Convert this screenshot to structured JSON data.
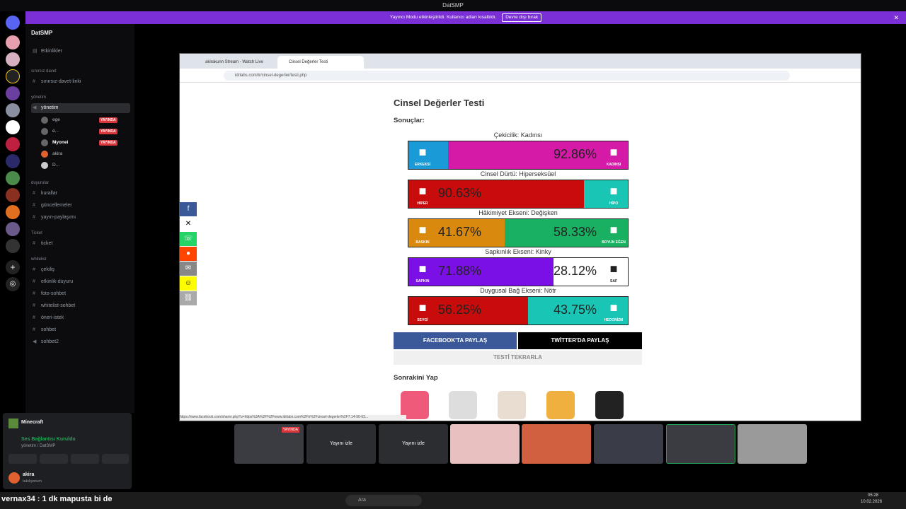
{
  "window_title": "DatSMP",
  "banner": {
    "text": "Yayıncı Modu etkinleştirildi. Kullanıcı adları kısaltıldı.",
    "button": "Devre dışı bırak"
  },
  "server_name": "DatSMP",
  "sidebar": {
    "events": "Etkinlikler",
    "cat_invite": "sınırsız davet",
    "ch_invite": "sınırsız-davet-linki",
    "cat_admin": "yönetim",
    "ch_admin": "yönetim",
    "users": [
      {
        "name": "ege",
        "live": "YAYINDA"
      },
      {
        "name": "é...",
        "live": "YAYINDA"
      },
      {
        "name": "Myonei",
        "live": "YAYINDA"
      },
      {
        "name": "akira",
        "live": ""
      },
      {
        "name": "D...",
        "live": ""
      }
    ],
    "cat_ann": "duyurular",
    "ch_rules": "kurallar",
    "ch_updates": "güncellemeler",
    "ch_share": "yayın-paylaşımı",
    "cat_ticket": "Ticket",
    "ch_ticket": "ticket",
    "cat_wl": "whitelist",
    "wl": [
      "çekiliş",
      "etkinlik-duyuru",
      "foto-sohbet",
      "whitelist-sohbet",
      "öneri-istek",
      "sohbet",
      "sohbet2"
    ]
  },
  "panel": {
    "activity": "Minecraft",
    "voice": "Ses Bağlantısı Kuruldu",
    "voice_sub": "yönetim / DatSMP",
    "user": "akira",
    "status": "takılıyorum"
  },
  "browser": {
    "tab1": "akirakunn Stream - Watch Live",
    "tab2": "Cinsel Değerler Testi",
    "url": "idrlabs.com/tr/cinsel-degerler/testi.php",
    "status_url": "https://www.facebook.com/sharer.php?u=https%3A%2F%2Fwww.idrlabs.com%2Ftr%2Fcinsel-degerler%2F7.14-90-63...",
    "title": "Cinsel Değerler Testi",
    "results": "Sonuçlar:",
    "next": "Sonrakini Yap",
    "fb_btn": "FACEBOOK'TA PAYLAŞ",
    "tw_btn": "TWİTTER'DA PAYLAŞ",
    "retry": "TESTİ TEKRARLA"
  },
  "chart_data": {
    "type": "bar",
    "axes": [
      {
        "label": "Çekicilik: Kadınsı",
        "left_name": "ERKEKSİ",
        "right_name": "KADINSI",
        "left_value": 7.14,
        "right_value": 92.86,
        "shown": "92.86%",
        "left_color": "#1a9ad6",
        "right_color": "#d41aa6"
      },
      {
        "label": "Cinsel Dürtü: Hiperseksüel",
        "left_name": "HİPER",
        "right_name": "HİPO",
        "left_value": 90.63,
        "right_value": 9.37,
        "shown": "90.63%",
        "left_color": "#c80c0c",
        "right_color": "#19c6b6"
      },
      {
        "label": "Hâkimiyet Ekseni: Değişken",
        "left_name": "BASKIN",
        "right_name": "BOYUN EĞEN",
        "left_value": 41.67,
        "right_value": 58.33,
        "shown_left": "41.67%",
        "shown_right": "58.33%",
        "left_color": "#d98a0e",
        "right_color": "#19b062"
      },
      {
        "label": "Sapkınlık Ekseni: Kinky",
        "left_name": "SAPKIN",
        "right_name": "SAF",
        "left_value": 71.88,
        "right_value": 28.12,
        "shown_left": "71.88%",
        "shown_right": "28.12%",
        "left_color": "#7a10e6",
        "right_color": "#ffffff"
      },
      {
        "label": "Duygusal Bağ Ekseni: Nötr",
        "left_name": "SEVGİ",
        "right_name": "HEDONİZM",
        "left_value": 56.25,
        "right_value": 43.75,
        "shown_left": "56.25%",
        "shown_right": "43.75%",
        "left_color": "#c80c0c",
        "right_color": "#19c6b6"
      }
    ]
  },
  "tiles": {
    "live": "YAYINDA",
    "watch": "Yayını izle"
  },
  "ticker": "vernax34 : 1 dk mapusta bi de",
  "taskbar": {
    "search": "Ara",
    "time": "05:28",
    "date": "10.02.2026"
  }
}
